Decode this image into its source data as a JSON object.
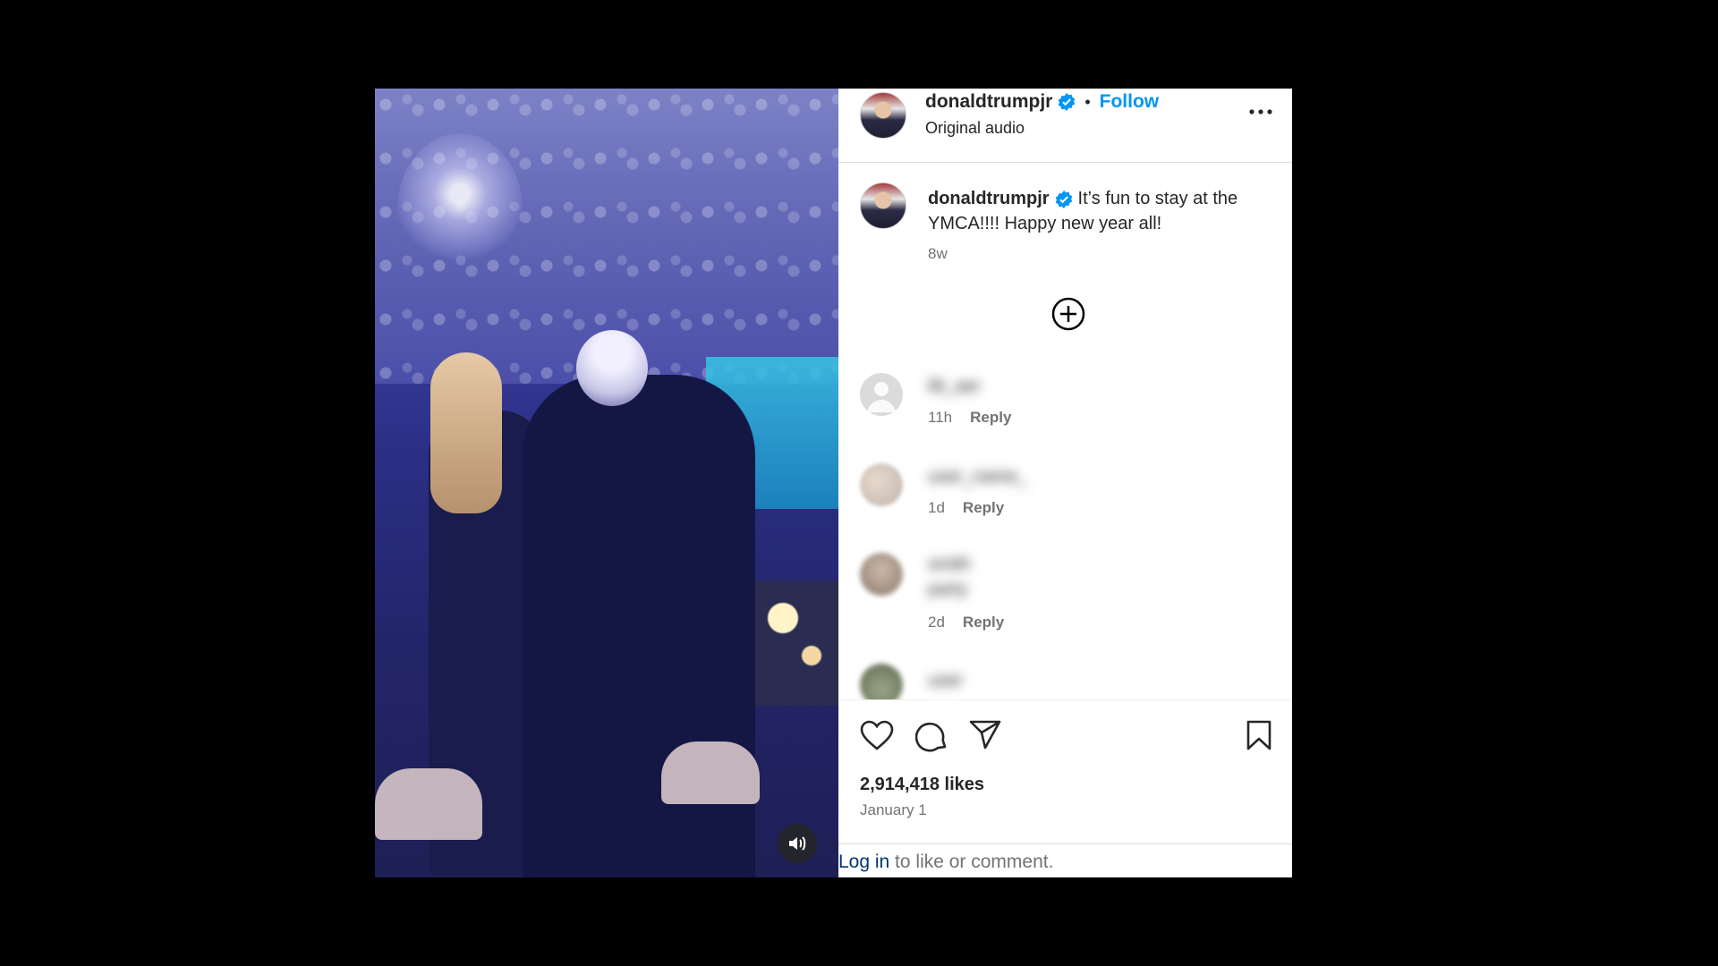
{
  "post": {
    "author": "donaldtrumpjr",
    "follow_label": "Follow",
    "audio": "Original audio",
    "caption": "It’s fun to stay at the YMCA!!!! Happy new year all!",
    "caption_time": "8w",
    "likes": "2,914,418 likes",
    "date": "January 1"
  },
  "comments": [
    {
      "author": "lilt_aer",
      "text": "",
      "time": "11h",
      "reply": "Reply"
    },
    {
      "author": "user_name_",
      "text": "",
      "time": "1d",
      "reply": "Reply"
    },
    {
      "author": "smith",
      "text": "party",
      "time": "2d",
      "reply": "Reply"
    },
    {
      "author": "user",
      "text": "",
      "time": "",
      "reply": ""
    }
  ],
  "login": {
    "link": "Log in",
    "rest": " to like or comment."
  },
  "icons": {
    "verified": "verified-badge-icon",
    "more": "more-options-icon",
    "load_more": "plus-circle-icon",
    "like": "heart-icon",
    "comment": "comment-bubble-icon",
    "share": "paper-plane-icon",
    "save": "bookmark-icon",
    "sound": "speaker-icon"
  },
  "colors": {
    "accent": "#0095f6",
    "verified": "#0095f6",
    "link": "#00376b",
    "muted": "#737373"
  }
}
